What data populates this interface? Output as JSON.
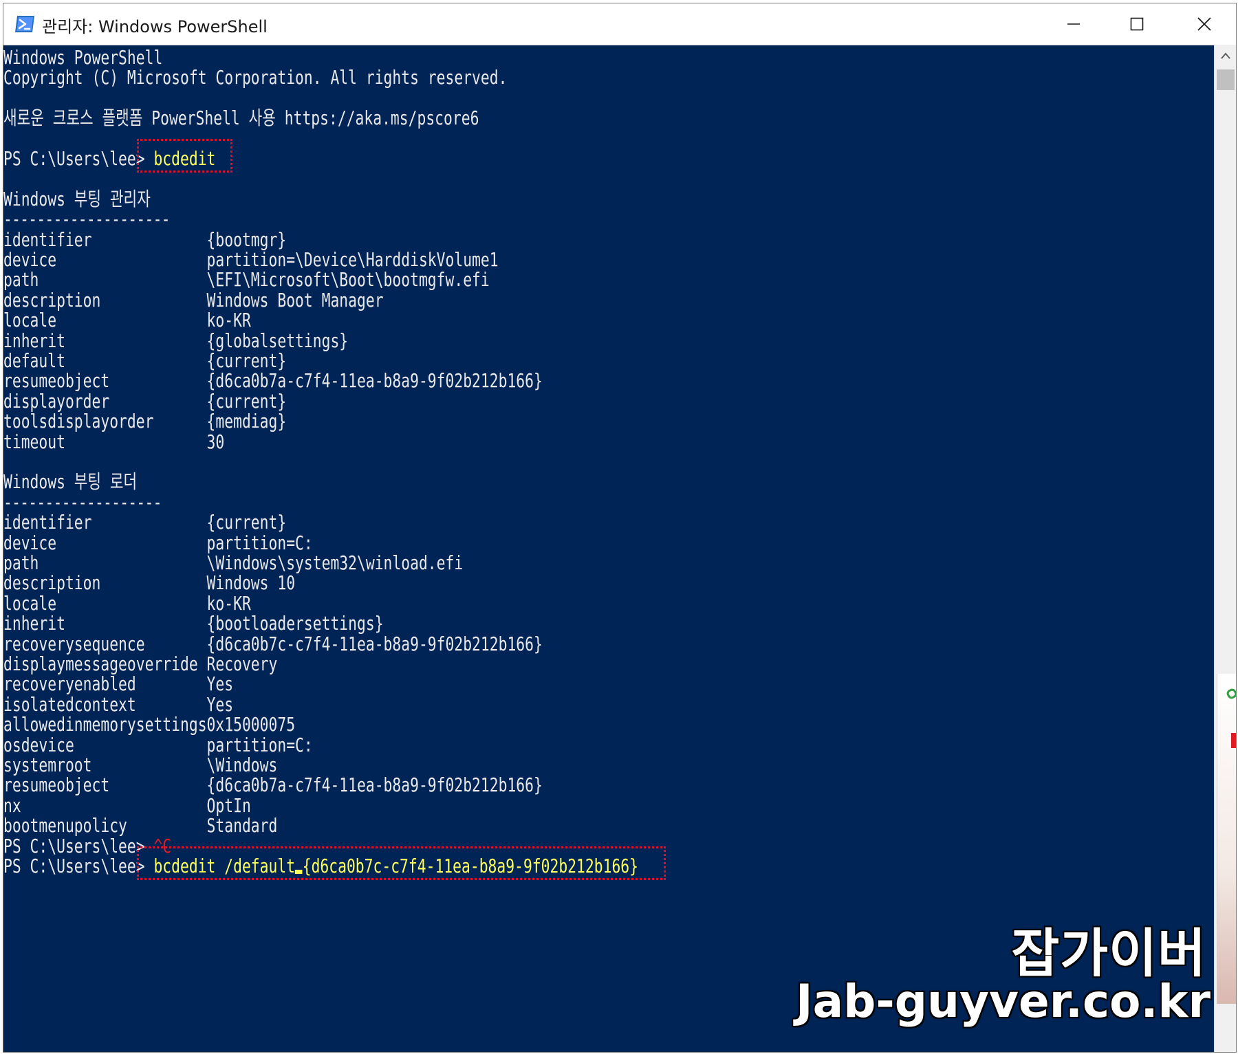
{
  "window": {
    "title": "관리자: Windows PowerShell",
    "icon": "powershell-icon",
    "controls": [
      "minimize-icon",
      "maximize-icon",
      "close-icon"
    ]
  },
  "console": {
    "banner": [
      "Windows PowerShell",
      "Copyright (C) Microsoft Corporation. All rights reserved.",
      "",
      "새로운 크로스 플랫폼 PowerShell 사용 https://aka.ms/pscore6"
    ],
    "prompt": "PS C:\\Users\\lee>",
    "command1": "bcdedit",
    "section1": {
      "heading": "Windows 부팅 관리자",
      "rule": "--------------------",
      "entries": [
        {
          "key": "identifier",
          "value": "{bootmgr}"
        },
        {
          "key": "device",
          "value": "partition=\\Device\\HarddiskVolume1"
        },
        {
          "key": "path",
          "value": "\\EFI\\Microsoft\\Boot\\bootmgfw.efi"
        },
        {
          "key": "description",
          "value": "Windows Boot Manager"
        },
        {
          "key": "locale",
          "value": "ko-KR"
        },
        {
          "key": "inherit",
          "value": "{globalsettings}"
        },
        {
          "key": "default",
          "value": "{current}"
        },
        {
          "key": "resumeobject",
          "value": "{d6ca0b7a-c7f4-11ea-b8a9-9f02b212b166}"
        },
        {
          "key": "displayorder",
          "value": "{current}"
        },
        {
          "key": "toolsdisplayorder",
          "value": "{memdiag}"
        },
        {
          "key": "timeout",
          "value": "30"
        }
      ]
    },
    "section2": {
      "heading": "Windows 부팅 로더",
      "rule": "-------------------",
      "entries": [
        {
          "key": "identifier",
          "value": "{current}"
        },
        {
          "key": "device",
          "value": "partition=C:"
        },
        {
          "key": "path",
          "value": "\\Windows\\system32\\winload.efi"
        },
        {
          "key": "description",
          "value": "Windows 10"
        },
        {
          "key": "locale",
          "value": "ko-KR"
        },
        {
          "key": "inherit",
          "value": "{bootloadersettings}"
        },
        {
          "key": "recoverysequence",
          "value": "{d6ca0b7c-c7f4-11ea-b8a9-9f02b212b166}"
        },
        {
          "key": "displaymessageoverride",
          "value": "Recovery"
        },
        {
          "key": "recoveryenabled",
          "value": "Yes"
        },
        {
          "key": "isolatedcontext",
          "value": "Yes"
        },
        {
          "key": "allowedinmemorysettings",
          "value": "0x15000075"
        },
        {
          "key": "osdevice",
          "value": "partition=C:"
        },
        {
          "key": "systemroot",
          "value": "\\Windows"
        },
        {
          "key": "resumeobject",
          "value": "{d6ca0b7a-c7f4-11ea-b8a9-9f02b212b166}"
        },
        {
          "key": "nx",
          "value": "OptIn"
        },
        {
          "key": "bootmenupolicy",
          "value": "Standard"
        }
      ]
    },
    "interrupt": "^C",
    "command2": "bcdedit /default",
    "command2_arg": "{d6ca0b7c-c7f4-11ea-b8a9-9f02b212b166}"
  },
  "watermark": {
    "brand": "잡가이버",
    "url": "Jab-guyver.co.kr"
  },
  "colors": {
    "console_bg": "#012456",
    "text": "#e8e8e8",
    "command": "#ffff5a",
    "highlight_box": "#e0102a",
    "ctrl_c": "#d81e28"
  }
}
